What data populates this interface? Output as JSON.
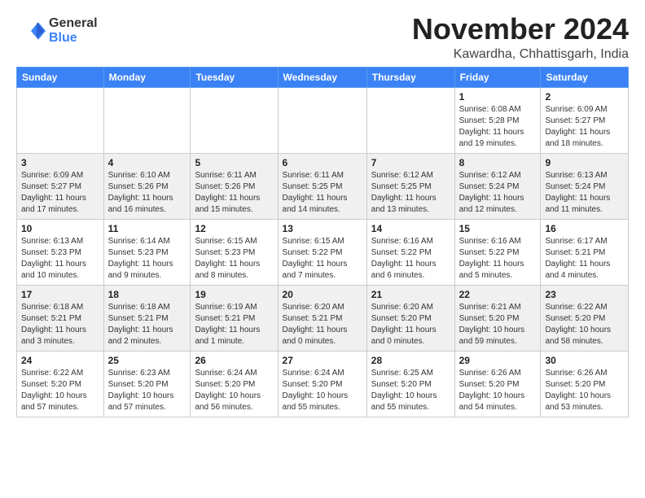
{
  "logo": {
    "general": "General",
    "blue": "Blue"
  },
  "title": "November 2024",
  "location": "Kawardha, Chhattisgarh, India",
  "days_of_week": [
    "Sunday",
    "Monday",
    "Tuesday",
    "Wednesday",
    "Thursday",
    "Friday",
    "Saturday"
  ],
  "weeks": [
    [
      {
        "day": "",
        "detail": ""
      },
      {
        "day": "",
        "detail": ""
      },
      {
        "day": "",
        "detail": ""
      },
      {
        "day": "",
        "detail": ""
      },
      {
        "day": "",
        "detail": ""
      },
      {
        "day": "1",
        "detail": "Sunrise: 6:08 AM\nSunset: 5:28 PM\nDaylight: 11 hours and 19 minutes."
      },
      {
        "day": "2",
        "detail": "Sunrise: 6:09 AM\nSunset: 5:27 PM\nDaylight: 11 hours and 18 minutes."
      }
    ],
    [
      {
        "day": "3",
        "detail": "Sunrise: 6:09 AM\nSunset: 5:27 PM\nDaylight: 11 hours and 17 minutes."
      },
      {
        "day": "4",
        "detail": "Sunrise: 6:10 AM\nSunset: 5:26 PM\nDaylight: 11 hours and 16 minutes."
      },
      {
        "day": "5",
        "detail": "Sunrise: 6:11 AM\nSunset: 5:26 PM\nDaylight: 11 hours and 15 minutes."
      },
      {
        "day": "6",
        "detail": "Sunrise: 6:11 AM\nSunset: 5:25 PM\nDaylight: 11 hours and 14 minutes."
      },
      {
        "day": "7",
        "detail": "Sunrise: 6:12 AM\nSunset: 5:25 PM\nDaylight: 11 hours and 13 minutes."
      },
      {
        "day": "8",
        "detail": "Sunrise: 6:12 AM\nSunset: 5:24 PM\nDaylight: 11 hours and 12 minutes."
      },
      {
        "day": "9",
        "detail": "Sunrise: 6:13 AM\nSunset: 5:24 PM\nDaylight: 11 hours and 11 minutes."
      }
    ],
    [
      {
        "day": "10",
        "detail": "Sunrise: 6:13 AM\nSunset: 5:23 PM\nDaylight: 11 hours and 10 minutes."
      },
      {
        "day": "11",
        "detail": "Sunrise: 6:14 AM\nSunset: 5:23 PM\nDaylight: 11 hours and 9 minutes."
      },
      {
        "day": "12",
        "detail": "Sunrise: 6:15 AM\nSunset: 5:23 PM\nDaylight: 11 hours and 8 minutes."
      },
      {
        "day": "13",
        "detail": "Sunrise: 6:15 AM\nSunset: 5:22 PM\nDaylight: 11 hours and 7 minutes."
      },
      {
        "day": "14",
        "detail": "Sunrise: 6:16 AM\nSunset: 5:22 PM\nDaylight: 11 hours and 6 minutes."
      },
      {
        "day": "15",
        "detail": "Sunrise: 6:16 AM\nSunset: 5:22 PM\nDaylight: 11 hours and 5 minutes."
      },
      {
        "day": "16",
        "detail": "Sunrise: 6:17 AM\nSunset: 5:21 PM\nDaylight: 11 hours and 4 minutes."
      }
    ],
    [
      {
        "day": "17",
        "detail": "Sunrise: 6:18 AM\nSunset: 5:21 PM\nDaylight: 11 hours and 3 minutes."
      },
      {
        "day": "18",
        "detail": "Sunrise: 6:18 AM\nSunset: 5:21 PM\nDaylight: 11 hours and 2 minutes."
      },
      {
        "day": "19",
        "detail": "Sunrise: 6:19 AM\nSunset: 5:21 PM\nDaylight: 11 hours and 1 minute."
      },
      {
        "day": "20",
        "detail": "Sunrise: 6:20 AM\nSunset: 5:21 PM\nDaylight: 11 hours and 0 minutes."
      },
      {
        "day": "21",
        "detail": "Sunrise: 6:20 AM\nSunset: 5:20 PM\nDaylight: 11 hours and 0 minutes."
      },
      {
        "day": "22",
        "detail": "Sunrise: 6:21 AM\nSunset: 5:20 PM\nDaylight: 10 hours and 59 minutes."
      },
      {
        "day": "23",
        "detail": "Sunrise: 6:22 AM\nSunset: 5:20 PM\nDaylight: 10 hours and 58 minutes."
      }
    ],
    [
      {
        "day": "24",
        "detail": "Sunrise: 6:22 AM\nSunset: 5:20 PM\nDaylight: 10 hours and 57 minutes."
      },
      {
        "day": "25",
        "detail": "Sunrise: 6:23 AM\nSunset: 5:20 PM\nDaylight: 10 hours and 57 minutes."
      },
      {
        "day": "26",
        "detail": "Sunrise: 6:24 AM\nSunset: 5:20 PM\nDaylight: 10 hours and 56 minutes."
      },
      {
        "day": "27",
        "detail": "Sunrise: 6:24 AM\nSunset: 5:20 PM\nDaylight: 10 hours and 55 minutes."
      },
      {
        "day": "28",
        "detail": "Sunrise: 6:25 AM\nSunset: 5:20 PM\nDaylight: 10 hours and 55 minutes."
      },
      {
        "day": "29",
        "detail": "Sunrise: 6:26 AM\nSunset: 5:20 PM\nDaylight: 10 hours and 54 minutes."
      },
      {
        "day": "30",
        "detail": "Sunrise: 6:26 AM\nSunset: 5:20 PM\nDaylight: 10 hours and 53 minutes."
      }
    ]
  ]
}
